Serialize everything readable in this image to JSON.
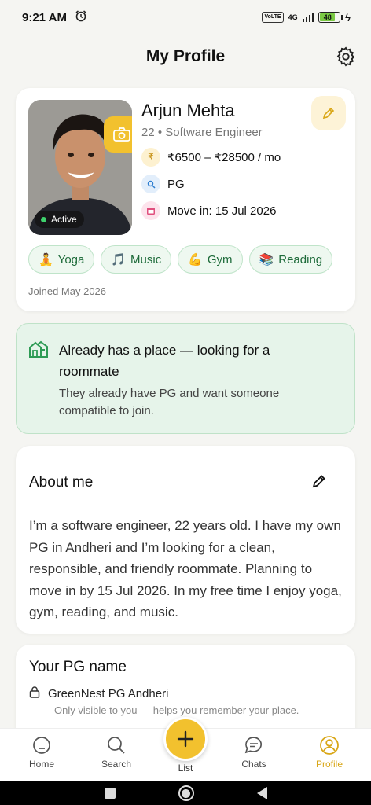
{
  "status_bar": {
    "time": "9:21 AM",
    "network": "4G",
    "volte": "VoLTE",
    "battery": "48"
  },
  "header": {
    "title": "My Profile"
  },
  "profile": {
    "name": "Arjun Mehta",
    "subtitle": "22 • Software Engineer",
    "status": "Active",
    "budget": "₹6500 – ₹28500 / mo",
    "budget_icon": "₹",
    "housing_type": "PG",
    "move_in": "Move in: 15 Jul 2026",
    "joined": "Joined May 2026",
    "interests": [
      {
        "emoji": "🧘",
        "label": "Yoga"
      },
      {
        "emoji": "🎵",
        "label": "Music"
      },
      {
        "emoji": "💪",
        "label": "Gym"
      },
      {
        "emoji": "📚",
        "label": "Reading"
      }
    ]
  },
  "banner": {
    "title": "Already has a place — looking for a roommate",
    "description": "They already have PG and want someone compatible to join."
  },
  "about": {
    "heading": "About me",
    "text": "I’m a software engineer, 22 years old. I have my own PG in Andheri and I’m looking for a clean, responsible, and friendly roommate. Planning to move in by 15 Jul 2026. In my free time I enjoy yoga, gym, reading, and music."
  },
  "pg": {
    "heading": "Your PG name",
    "name": "GreenNest PG Andheri",
    "hint": "Only visible to you — helps you remember your place."
  },
  "nav": {
    "items": [
      {
        "label": "Home",
        "icon": "home-icon"
      },
      {
        "label": "Search",
        "icon": "search-icon"
      },
      {
        "label": "List",
        "icon": "plus-icon"
      },
      {
        "label": "Chats",
        "icon": "chat-icon"
      },
      {
        "label": "Profile",
        "icon": "profile-icon"
      }
    ],
    "active": "Profile"
  },
  "colors": {
    "accent": "#f2c12e",
    "active_nav": "#d9a718",
    "chip_green": "#1e6b3a",
    "banner_bg": "#e6f4ea",
    "online": "#3ed16c"
  }
}
